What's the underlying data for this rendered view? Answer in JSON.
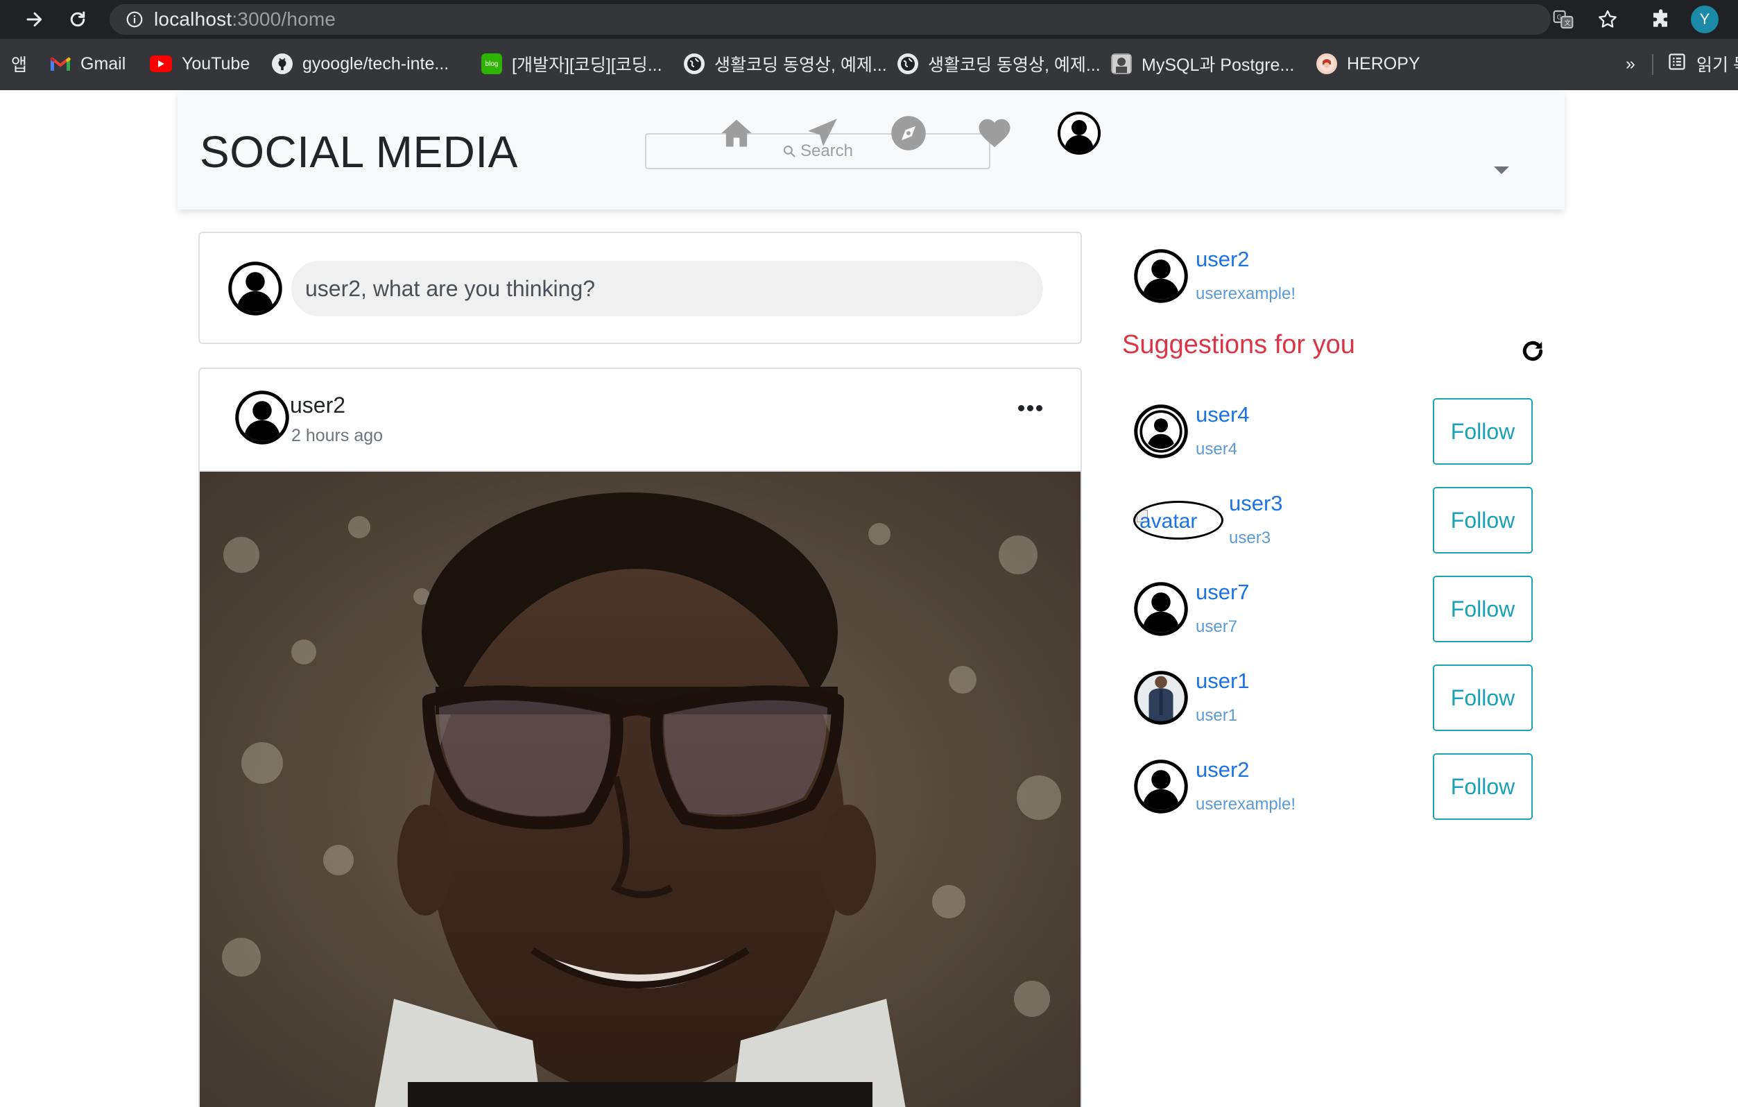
{
  "browser": {
    "url_host": "localhost",
    "url_path": ":3000/home",
    "profile_initial": "Y",
    "bookmarks": [
      {
        "label": "앱",
        "icon": "apps-grid-icon"
      },
      {
        "label": "Gmail",
        "icon": "gmail-icon"
      },
      {
        "label": "YouTube",
        "icon": "youtube-icon"
      },
      {
        "label": "gyoogle/tech-inte...",
        "icon": "github-icon"
      },
      {
        "label": "[개발자][코딩][코딩...",
        "icon": "blog-icon"
      },
      {
        "label": "생활코딩 동영상, 예제...",
        "icon": "globe-icon"
      },
      {
        "label": "생활코딩 동영상, 예제...",
        "icon": "globe-icon"
      },
      {
        "label": "MySQL과 Postgre...",
        "icon": "photo-favicon-icon"
      },
      {
        "label": "HEROPY",
        "icon": "heropy-icon"
      }
    ],
    "more_label": "»",
    "reading_list_label": "읽기 목"
  },
  "navbar": {
    "brand": "SOCIAL MEDIA",
    "search_placeholder": "Search",
    "icons": [
      "home-icon",
      "send-icon",
      "compass-icon",
      "heart-icon",
      "profile-icon"
    ]
  },
  "composer": {
    "placeholder": "user2, what are you thinking?"
  },
  "post": {
    "author": "user2",
    "time": "2 hours ago"
  },
  "sidebar": {
    "me": {
      "name": "user2",
      "sub": "userexample!"
    },
    "suggestions_title": "Suggestions for you",
    "follow_label": "Follow",
    "avatar_alt": "avatar",
    "suggestions": [
      {
        "name": "user4",
        "sub": "user4"
      },
      {
        "name": "user3",
        "sub": "user3"
      },
      {
        "name": "user7",
        "sub": "user7"
      },
      {
        "name": "user1",
        "sub": "user1"
      },
      {
        "name": "user2",
        "sub": "userexample!"
      }
    ]
  },
  "colors": {
    "brand_link": "#1a73e8",
    "suggestions_title": "#dc3545",
    "follow_outline": "#17a2b8"
  }
}
